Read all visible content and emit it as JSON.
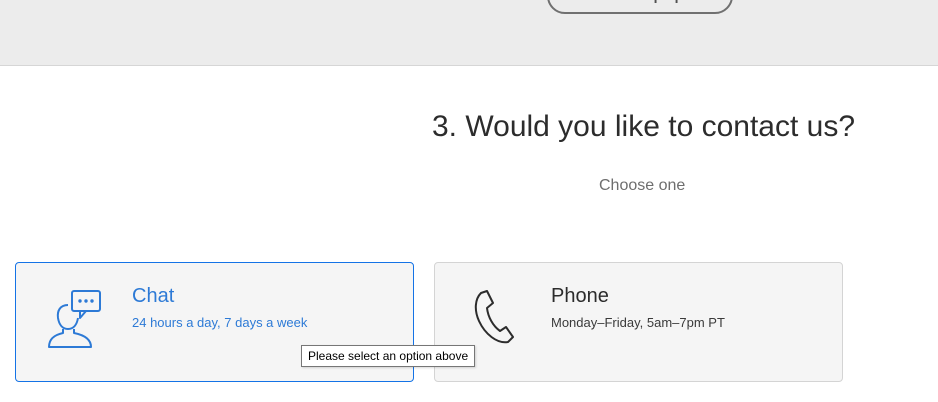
{
  "top_band": {
    "self_help_button_label": "Show self-help options"
  },
  "contact_section": {
    "title": "3. Would you like to contact us?",
    "subtitle": "Choose one"
  },
  "options": {
    "chat": {
      "title": "Chat",
      "description": "24 hours a day, 7 days a week",
      "icon": "chat-person-icon",
      "selected": true
    },
    "phone": {
      "title": "Phone",
      "description": "Monday–Friday, 5am–7pm PT",
      "icon": "phone-handset-icon",
      "selected": false
    }
  },
  "tooltip": {
    "text": "Please select an option above"
  },
  "colors": {
    "accent_blue": "#1473e6",
    "chat_text_blue": "#2d7ad6",
    "band_gray": "#ececec",
    "card_bg": "#f5f5f5"
  }
}
